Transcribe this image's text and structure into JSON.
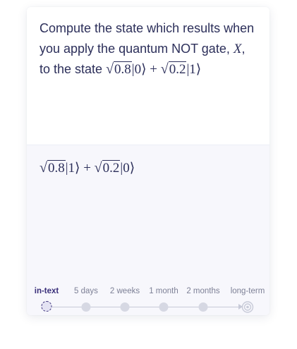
{
  "prompt": {
    "text_before": "Compute the state which results when you apply the quantum NOT gate, ",
    "gate_symbol": "X",
    "text_middle": ", to the state ",
    "coef_a": "0.8",
    "ket_a": "|0⟩",
    "plus": "+",
    "coef_b": "0.2",
    "ket_b": "|1⟩"
  },
  "answer": {
    "coef_a": "0.8",
    "ket_a": "|1⟩",
    "plus": "+",
    "coef_b": "0.2",
    "ket_b": "|0⟩"
  },
  "timeline": {
    "stages": [
      "in-text",
      "5 days",
      "2 weeks",
      "1 month",
      "2 months",
      "long-term"
    ],
    "current_stage": "in-text"
  },
  "colors": {
    "text": "#2c2f5a",
    "accent": "#3a2f7a",
    "answer_bg": "#f7f7fc",
    "muted": "#7d8096"
  }
}
